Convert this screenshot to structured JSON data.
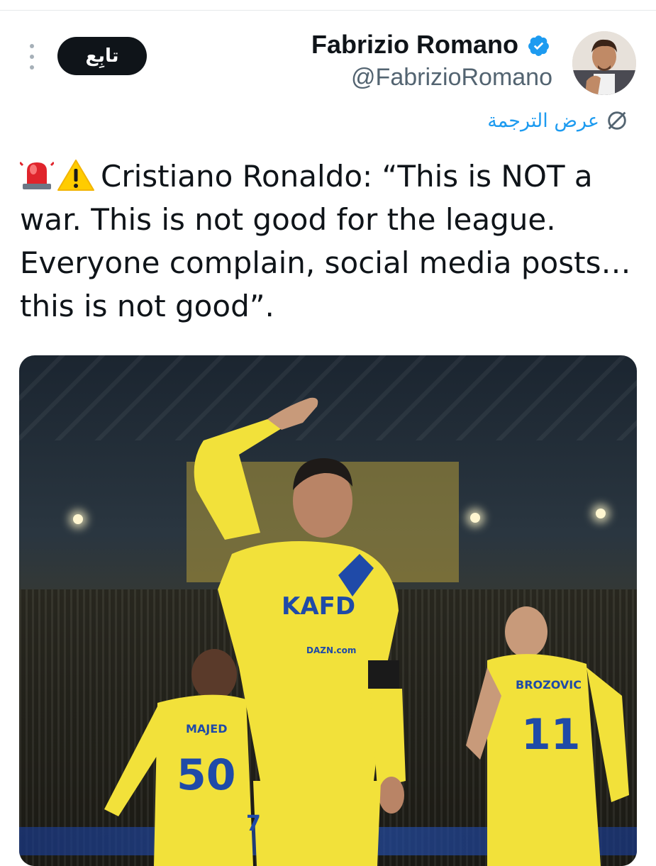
{
  "author": {
    "display_name": "Fabrizio Romano",
    "handle": "@FabrizioRomano",
    "verified": true
  },
  "actions": {
    "follow_label": "تابِع",
    "translate_label": "عرض الترجمة"
  },
  "tweet": {
    "text": "Cristiano Ronaldo: “This is NOT a war. This is not good for the league. Everyone complain, social media posts… this is not good”."
  },
  "media": {
    "jersey_text": {
      "sponsor": "KAFD",
      "sub_sponsor": "DAZN.com",
      "center_number": "7",
      "left_name": "MAJED",
      "left_number": "50",
      "right_name": "BROZOVIC",
      "right_number": "11"
    }
  },
  "colors": {
    "verified_badge": "#1d9bf0",
    "link": "#1d9bf0",
    "follow_button": "#0f1419",
    "jersey_yellow": "#f2e13a",
    "jersey_blue": "#1f4aa8"
  }
}
